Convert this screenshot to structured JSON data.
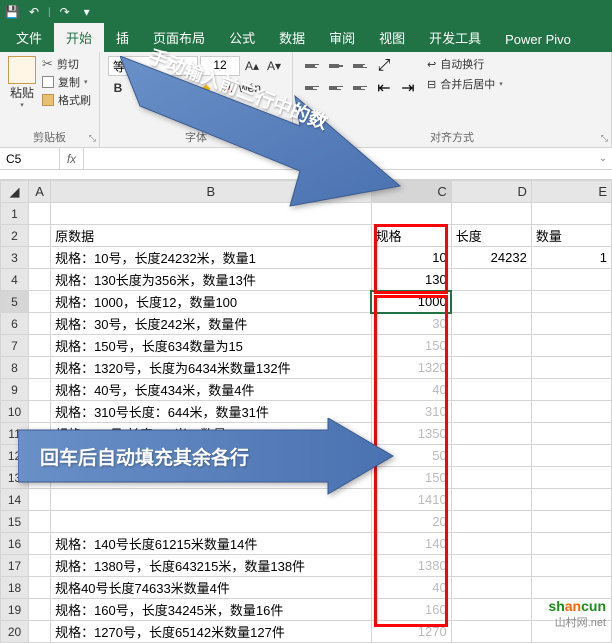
{
  "titlebar": {
    "save_icon": "save-icon",
    "undo_icon": "undo-icon",
    "redo_icon": "redo-icon",
    "dropdown": "▾"
  },
  "tabs": {
    "file": "文件",
    "home": "开始",
    "insert": "插",
    "page_layout": "页面布局",
    "formulas": "公式",
    "data": "数据",
    "review": "审阅",
    "view": "视图",
    "developer": "开发工具",
    "power_pivot": "Power Pivo"
  },
  "ribbon": {
    "paste": "粘贴",
    "cut": "剪切",
    "copy": "复制",
    "format_painter": "格式刷",
    "clipboard_label": "剪贴板",
    "font_name": "等线",
    "font_size": "12",
    "font_label": "字体",
    "wrap_text": "自动换行",
    "merge_center": "合并后居中",
    "align_label": "对齐方式"
  },
  "name_box": "C5",
  "formula_bar": "",
  "headers": {
    "A": "A",
    "B": "B",
    "C": "C",
    "D": "D",
    "E": "E"
  },
  "rows": {
    "1": {
      "b": ""
    },
    "2": {
      "b": "原数据",
      "c": "规格",
      "d": "长度",
      "e": "数量"
    },
    "3": {
      "b": "规格：10号，长度24232米，数量1",
      "c": "10",
      "d": "24232",
      "e": "1"
    },
    "4": {
      "b": "规格：130长度为356米，数量13件",
      "c": "130"
    },
    "5": {
      "b": "规格：1000，长度12，数量100",
      "c": "1000"
    },
    "6": {
      "b": "规格：30号，长度242米，数量件",
      "c_f": "30"
    },
    "7": {
      "b": "规格：150号，长度634数量为15",
      "c_f": "150"
    },
    "8": {
      "b": "规格：1320号，长度为6434米数量132件",
      "c_f": "1320"
    },
    "9": {
      "b": "规格：40号，长度434米，数量4件",
      "c_f": "40"
    },
    "10": {
      "b": "规格：310号长度：644米，数量31件",
      "c_f": "310"
    },
    "11": {
      "b": "规格1350号  长度643米，数量135",
      "c_f": "1350"
    },
    "12": {
      "b": "",
      "c_f": "50"
    },
    "13": {
      "b": "",
      "c_f": "150"
    },
    "14": {
      "b": "",
      "c_f": "1410"
    },
    "15": {
      "b": "",
      "c_f": "20"
    },
    "16": {
      "b": "规格：140号长度61215米数量14件",
      "c_f": "140"
    },
    "17": {
      "b": "规格：1380号，长度643215米，数量138件",
      "c_f": "1380"
    },
    "18": {
      "b": "规格40号长度74633米数量4件",
      "c_f": "40"
    },
    "19": {
      "b": "规格：160号，长度34245米，数量16件",
      "c_f": "160"
    },
    "20": {
      "b": "规格：1270号，长度65142米数量127件",
      "c_f": "1270"
    }
  },
  "callouts": {
    "top": "手动输入前三行中的数",
    "bottom": "回车后自动填充其余各行"
  },
  "watermark": {
    "sh": "sh",
    "an": "an",
    "cun": "cun",
    "net": "山村网.net"
  }
}
